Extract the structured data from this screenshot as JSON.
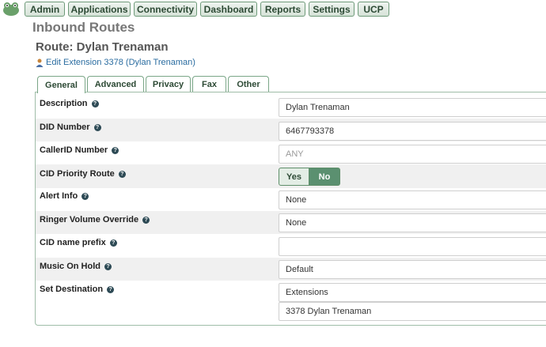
{
  "nav": {
    "items": [
      {
        "label": "Admin"
      },
      {
        "label": "Applications"
      },
      {
        "label": "Connectivity"
      },
      {
        "label": "Dashboard"
      },
      {
        "label": "Reports"
      },
      {
        "label": "Settings"
      },
      {
        "label": "UCP"
      }
    ]
  },
  "header": {
    "page_title": "Inbound Routes",
    "route_title": "Route: Dylan Trenaman",
    "edit_link": "Edit Extension 3378 (Dylan Trenaman)"
  },
  "tabs": [
    {
      "label": "General",
      "active": true
    },
    {
      "label": "Advanced"
    },
    {
      "label": "Privacy"
    },
    {
      "label": "Fax"
    },
    {
      "label": "Other"
    }
  ],
  "form": {
    "description": {
      "label": "Description",
      "value": "Dylan Trenaman"
    },
    "did_number": {
      "label": "DID Number",
      "value": "6467793378"
    },
    "callerid_number": {
      "label": "CallerID Number",
      "placeholder": "ANY"
    },
    "cid_priority": {
      "label": "CID Priority Route",
      "yes": "Yes",
      "no": "No",
      "selected": "No"
    },
    "alert_info": {
      "label": "Alert Info",
      "value": "None"
    },
    "ringer_volume": {
      "label": "Ringer Volume Override",
      "value": "None"
    },
    "cid_prefix": {
      "label": "CID name prefix",
      "value": ""
    },
    "music_on_hold": {
      "label": "Music On Hold",
      "value": "Default"
    },
    "set_destination": {
      "label": "Set Destination",
      "type": "Extensions",
      "target": "3378 Dylan Trenaman"
    }
  },
  "colors": {
    "accent": "#5b9070",
    "nav_border": "#6e9a79",
    "link": "#2a6ca0"
  },
  "icons": {
    "logo": "frog-logo-icon",
    "help": "help-icon",
    "user": "user-icon"
  }
}
